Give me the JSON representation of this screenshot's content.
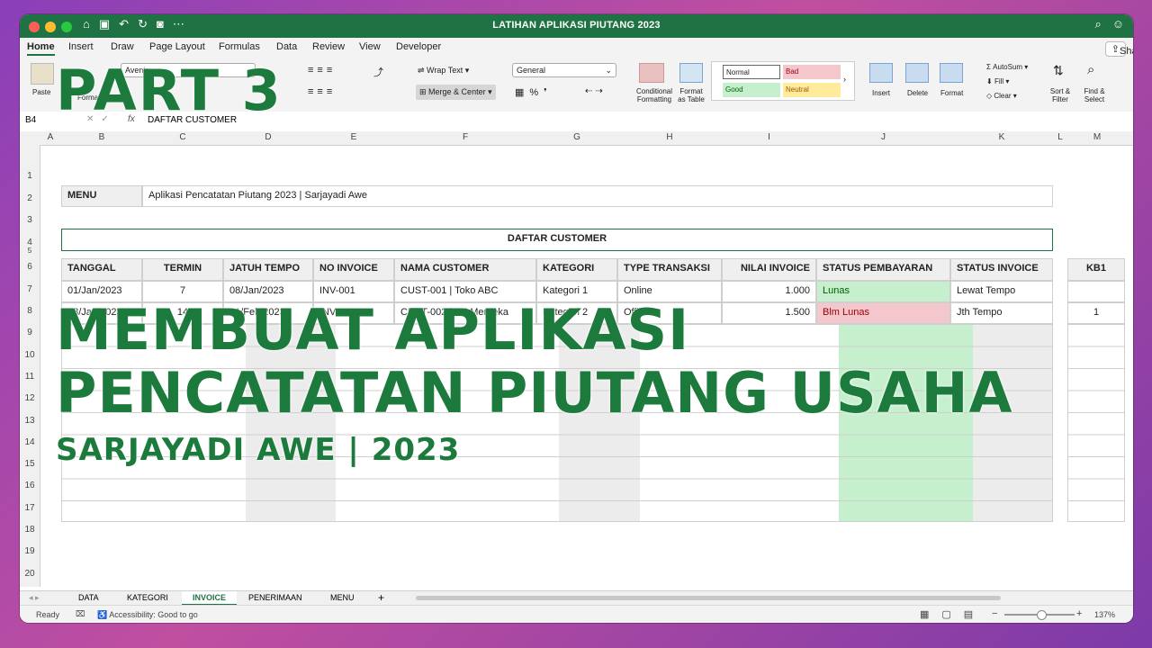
{
  "window": {
    "title": "LATIHAN APLIKASI PIUTANG 2023"
  },
  "ribbon": {
    "tabs": [
      "Home",
      "Insert",
      "Draw",
      "Page Layout",
      "Formulas",
      "Data",
      "Review",
      "View",
      "Developer"
    ],
    "share": "Share",
    "paste": "Paste",
    "format_painter": "Format",
    "font_name": "Avenir",
    "wrap_text": "Wrap Text",
    "merge_center": "Merge & Center",
    "number_format": "General",
    "conditional_formatting": "Conditional Formatting",
    "format_as_table": "Format as Table",
    "style_normal": "Normal",
    "style_bad": "Bad",
    "style_good": "Good",
    "style_neutral": "Neutral",
    "insert": "Insert",
    "delete": "Delete",
    "format": "Format",
    "autosum": "AutoSum",
    "fill": "Fill",
    "clear": "Clear",
    "sort_filter": "Sort & Filter",
    "find_select": "Find & Select"
  },
  "formula_bar": {
    "cell_ref": "B4",
    "content": "DAFTAR CUSTOMER"
  },
  "columns": [
    "A",
    "B",
    "C",
    "D",
    "E",
    "F",
    "G",
    "H",
    "I",
    "J",
    "K",
    "L",
    "M"
  ],
  "rows": [
    "1",
    "2",
    "3",
    "4",
    "5",
    "6",
    "7",
    "8",
    "9",
    "10",
    "11",
    "12",
    "13",
    "14",
    "15",
    "16",
    "17",
    "18",
    "19",
    "20"
  ],
  "sheet": {
    "menu_label": "MENU",
    "menu_value": "Aplikasi Pencatatan Piutang 2023 | Sarjayadi Awe",
    "banner": "DAFTAR CUSTOMER",
    "headers": [
      "TANGGAL",
      "TERMIN",
      "JATUH TEMPO",
      "NO INVOICE",
      "NAMA CUSTOMER",
      "KATEGORI",
      "TYPE TRANSAKSI",
      "NILAI INVOICE",
      "STATUS PEMBAYARAN",
      "STATUS INVOICE",
      "KB1"
    ],
    "rows": [
      [
        "01/Jan/2023",
        "7",
        "08/Jan/2023",
        "INV-001",
        "CUST-001 | Toko ABC",
        "Kategori 1",
        "Online",
        "1.000",
        "Lunas",
        "Lewat Tempo",
        ""
      ],
      [
        "18/Jan/2023",
        "14",
        "01/Feb/2023",
        "INV-002",
        "CUST-002 | PT Merdeka",
        "Kategori 2",
        "Offline",
        "1.500",
        "Blm Lunas",
        "Jth Tempo",
        "1"
      ]
    ]
  },
  "sheet_tabs": [
    "DATA",
    "KATEGORI",
    "INVOICE",
    "PENERIMAAN",
    "MENU"
  ],
  "status_bar": {
    "ready": "Ready",
    "accessibility": "Accessibility: Good to go",
    "zoom": "137%"
  },
  "overlay": {
    "part": "PART 3",
    "line1": "MEMBUAT APLIKASI",
    "line2": "PENCATATAN PIUTANG USAHA",
    "line3": "SARJAYADI AWE | 2023"
  },
  "colors": {
    "excel_green": "#1f7244",
    "overlay_green": "#1c7a3c",
    "lunas_bg": "#c6efce",
    "blm_lunas_bg": "#f4c7cc"
  }
}
